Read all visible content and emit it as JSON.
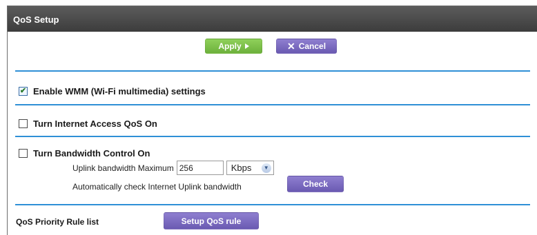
{
  "panel": {
    "title": "QoS Setup"
  },
  "toolbar": {
    "apply_label": "Apply",
    "cancel_label": "Cancel"
  },
  "wmm": {
    "label": "Enable WMM (Wi-Fi multimedia) settings",
    "checked": true
  },
  "internet_qos": {
    "label": "Turn Internet Access QoS On",
    "checked": false
  },
  "bandwidth": {
    "label": "Turn Bandwidth Control On",
    "checked": false,
    "uplink_label": "Uplink bandwidth Maximum",
    "uplink_value": "256",
    "unit_selected": "Kbps",
    "auto_check_label": "Automatically check Internet Uplink bandwidth",
    "check_label": "Check"
  },
  "rules": {
    "label": "QoS Priority Rule list",
    "setup_label": "Setup QoS rule"
  },
  "colors": {
    "header": "#4a4a4a",
    "apply": "#7cc04a",
    "purple": "#7b6bc4",
    "divider": "#2e8fd6"
  }
}
